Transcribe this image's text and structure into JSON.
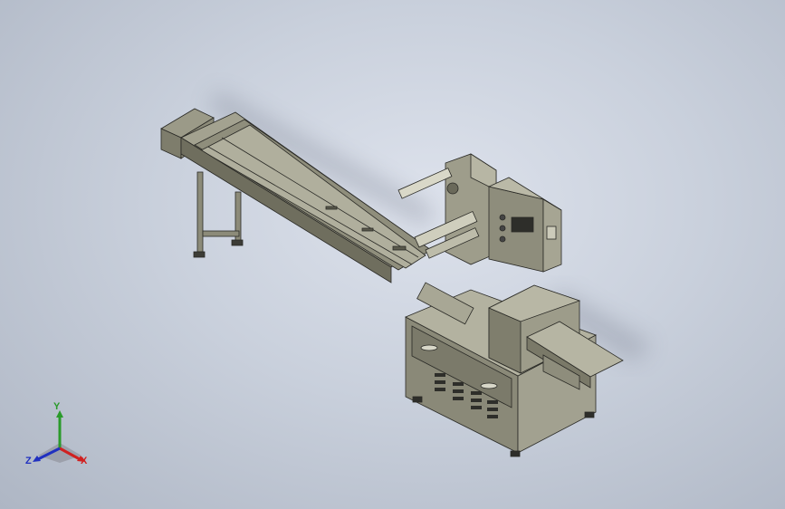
{
  "viewport": {
    "model": "horizontal-flow-wrapper-assembly",
    "display_style": "shaded-with-edges"
  },
  "triad": {
    "x_label": "X",
    "y_label": "Y",
    "z_label": "Z",
    "colors": {
      "x": "#d02020",
      "y": "#2a9a2a",
      "z": "#2030c0"
    }
  }
}
